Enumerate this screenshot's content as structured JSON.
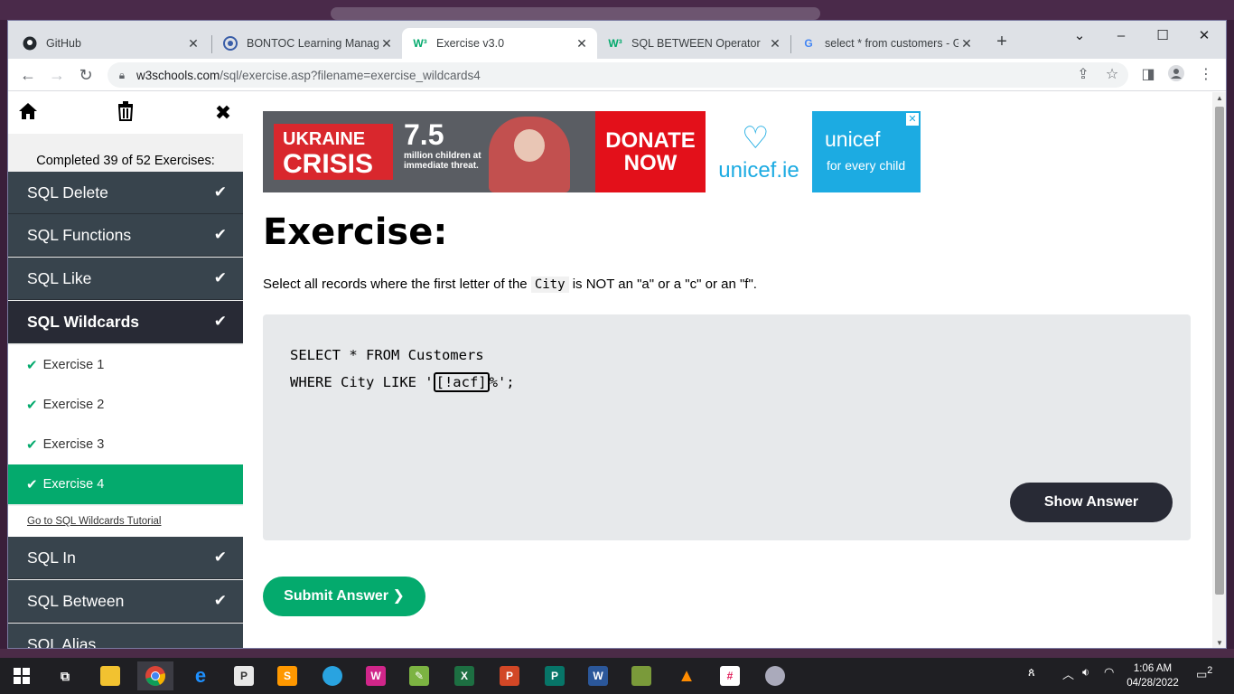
{
  "browser": {
    "tabs": [
      {
        "title": "GitHub",
        "icon": "github-icon"
      },
      {
        "title": "BONTOC Learning Managem",
        "icon": "lms-icon"
      },
      {
        "title": "Exercise v3.0",
        "icon": "w3schools-icon",
        "active": true
      },
      {
        "title": "SQL BETWEEN Operator",
        "icon": "w3schools-icon"
      },
      {
        "title": "select * from customers - Go",
        "icon": "google-icon"
      }
    ],
    "url_host": "w3schools.com",
    "url_path": "/sql/exercise.asp?filename=exercise_wildcards4"
  },
  "sidebar": {
    "completed": "Completed 39 of 52 Exercises:",
    "categories_above": [
      {
        "label": "SQL Delete"
      },
      {
        "label": "SQL Functions"
      },
      {
        "label": "SQL Like"
      },
      {
        "label": "SQL Wildcards"
      }
    ],
    "exercises": [
      {
        "label": "Exercise 1"
      },
      {
        "label": "Exercise 2"
      },
      {
        "label": "Exercise 3"
      },
      {
        "label": "Exercise 4"
      }
    ],
    "tutorial_link": "Go to SQL Wildcards Tutorial",
    "categories_below": [
      {
        "label": "SQL In"
      },
      {
        "label": "SQL Between"
      },
      {
        "label": "SQL Alias"
      }
    ]
  },
  "ad": {
    "ukraine_line1": "UKRAINE",
    "ukraine_line2": "CRISIS",
    "number": "7.5",
    "desc": "million children at immediate threat.",
    "donate_line1": "DONATE",
    "donate_line2": "NOW",
    "unicef_ie": "unicef.ie",
    "unicef": "unicef",
    "for_every_child": "for every child"
  },
  "main": {
    "title": "Exercise:",
    "instruction_pre": "Select all records where the first letter of the ",
    "instruction_code": "City",
    "instruction_post": " is NOT an \"a\" or a \"c\" or an \"f\".",
    "code_line1": "SELECT * FROM Customers",
    "code_line2_pre": "WHERE City LIKE '",
    "answer_value": "[!acf]",
    "code_line2_post": "%';",
    "show_answer": "Show Answer",
    "submit": "Submit Answer ❯"
  },
  "taskbar": {
    "time": "1:06 AM",
    "date": "04/28/2022",
    "notifications": "2"
  },
  "colors": {
    "w3_green": "#04aa6d",
    "sidebar_dark": "#38444d",
    "dark_button": "#282a35"
  }
}
